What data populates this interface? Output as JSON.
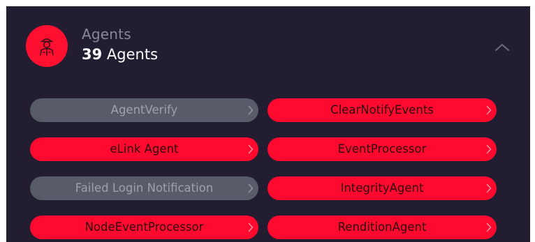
{
  "header": {
    "title": "Agents",
    "count_number": "39",
    "count_label": "Agents",
    "avatar_icon": "agent-icon",
    "collapse_icon": "chevron-up-icon"
  },
  "colors": {
    "background": "#221d31",
    "accent_red": "#ff0a2e",
    "inactive_gray": "#585b68"
  },
  "agents": [
    {
      "label": "AgentVerify",
      "status": "inactive"
    },
    {
      "label": "ClearNotifyEvents",
      "status": "active"
    },
    {
      "label": "eLink Agent",
      "status": "active"
    },
    {
      "label": "EventProcessor",
      "status": "active"
    },
    {
      "label": "Failed Login Notification",
      "status": "inactive"
    },
    {
      "label": "IntegrityAgent",
      "status": "active"
    },
    {
      "label": "NodeEventProcessor",
      "status": "active"
    },
    {
      "label": "RenditionAgent",
      "status": "active"
    }
  ]
}
